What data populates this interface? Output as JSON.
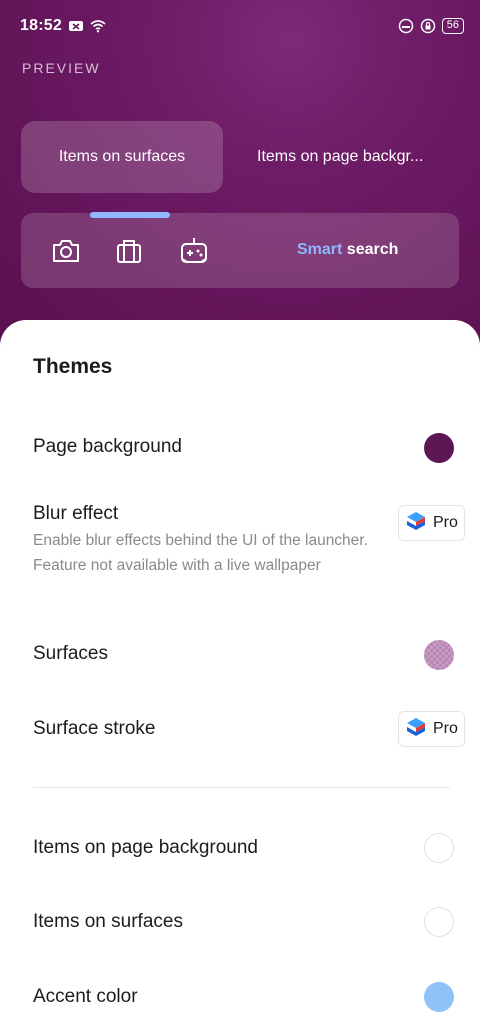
{
  "status_bar": {
    "time": "18:52",
    "battery": "56"
  },
  "preview": {
    "label": "PREVIEW",
    "tabs": [
      {
        "label": "Items on surfaces",
        "active": true
      },
      {
        "label": "Items on page backgr...",
        "active": false
      }
    ],
    "dock": {
      "icons": [
        "camera-icon",
        "shopping-bag-icon",
        "gamepad-icon"
      ],
      "search_accent": "Smart",
      "search_rest": " search"
    }
  },
  "themes": {
    "title": "Themes",
    "rows": [
      {
        "label": "Page background",
        "swatch_color": "#5c1652"
      },
      {
        "label": "Blur effect",
        "description": "Enable blur effects behind the UI of the launcher. Feature not available with a live wallpaper",
        "badge": "Pro"
      },
      {
        "label": "Surfaces",
        "swatch_color": "#c89ac3"
      },
      {
        "label": "Surface stroke",
        "badge": "Pro"
      },
      {
        "label": "Items on page background",
        "swatch_color": "#ffffff"
      },
      {
        "label": "Items on surfaces",
        "swatch_color": "#ffffff"
      },
      {
        "label": "Accent color",
        "swatch_color": "#8fc3f7"
      }
    ]
  },
  "colors": {
    "accent_blue": "#8fb8ff",
    "header_purple": "#621458"
  }
}
